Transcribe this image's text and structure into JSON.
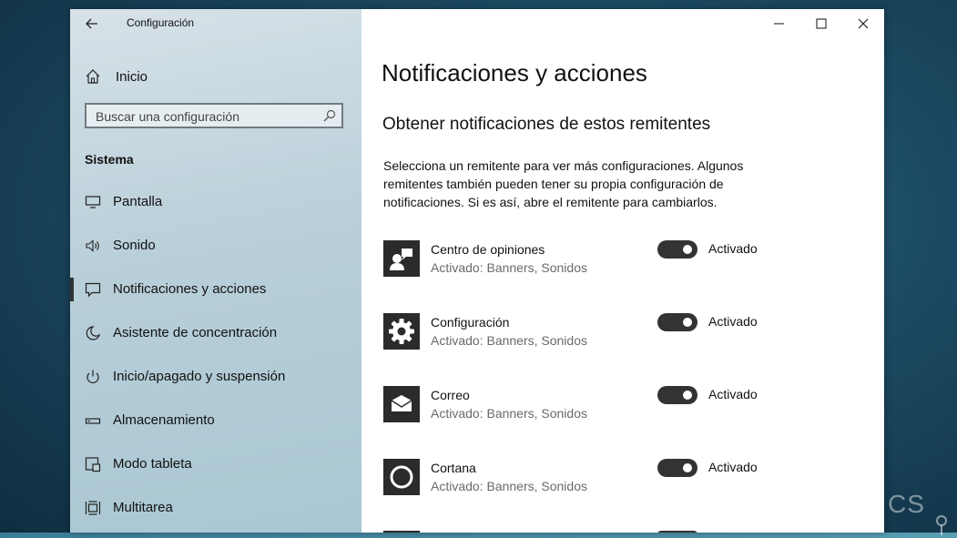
{
  "window": {
    "title": "Configuración"
  },
  "sidebar": {
    "home_label": "Inicio",
    "search_placeholder": "Buscar una configuración",
    "section_label": "Sistema",
    "items": [
      {
        "label": "Pantalla",
        "icon": "monitor-icon"
      },
      {
        "label": "Sonido",
        "icon": "speaker-icon"
      },
      {
        "label": "Notificaciones y acciones",
        "icon": "notification-icon",
        "active": true
      },
      {
        "label": "Asistente de concentración",
        "icon": "moon-icon"
      },
      {
        "label": "Inicio/apagado y suspensión",
        "icon": "power-icon"
      },
      {
        "label": "Almacenamiento",
        "icon": "storage-icon"
      },
      {
        "label": "Modo tableta",
        "icon": "tablet-icon"
      },
      {
        "label": "Multitarea",
        "icon": "multitask-icon"
      }
    ]
  },
  "main": {
    "title": "Notificaciones y acciones",
    "subtitle": "Obtener notificaciones de estos remitentes",
    "description": "Selecciona un remitente para ver más configuraciones. Algunos remitentes también pueden tener su propia configuración de notificaciones. Si es así, abre el remitente para cambiarlos.",
    "senders": [
      {
        "name": "Centro de opiniones",
        "status": "Activado: Banners, Sonidos",
        "toggle_label": "Activado",
        "on": true,
        "icon": "feedback-hub-icon"
      },
      {
        "name": "Configuración",
        "status": "Activado: Banners, Sonidos",
        "toggle_label": "Activado",
        "on": true,
        "icon": "gear-icon"
      },
      {
        "name": "Correo",
        "status": "Activado: Banners, Sonidos",
        "toggle_label": "Activado",
        "on": true,
        "icon": "mail-icon"
      },
      {
        "name": "Cortana",
        "status": "Activado: Banners, Sonidos",
        "toggle_label": "Activado",
        "on": true,
        "icon": "cortana-icon"
      }
    ]
  },
  "watermark": "CS"
}
